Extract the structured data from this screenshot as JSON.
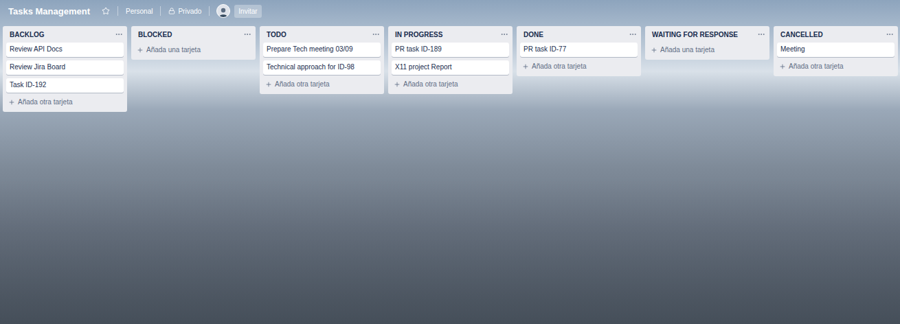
{
  "board": {
    "title": "Tasks Management",
    "starred": false,
    "team": "Personal",
    "visibility": "Privado",
    "invite": "Invitar"
  },
  "lists": [
    {
      "title": "BACKLOG",
      "cards": [
        "Review API Docs",
        "Review Jira Board",
        "Task ID-192"
      ],
      "add": "Añada otra tarjeta"
    },
    {
      "title": "BLOCKED",
      "cards": [],
      "add": "Añada una tarjeta"
    },
    {
      "title": "TODO",
      "cards": [
        "Prepare Tech meeting 03/09",
        "Technical approach for ID-98"
      ],
      "add": "Añada otra tarjeta"
    },
    {
      "title": "IN PROGRESS",
      "cards": [
        "PR task ID-189",
        "X11 project Report"
      ],
      "add": "Añada otra tarjeta"
    },
    {
      "title": "DONE",
      "cards": [
        "PR task ID-77"
      ],
      "add": "Añada otra tarjeta"
    },
    {
      "title": "WAITING FOR RESPONSE",
      "cards": [],
      "add": "Añada una tarjeta"
    },
    {
      "title": "CANCELLED",
      "cards": [
        "Meeting"
      ],
      "add": "Añada otra tarjeta"
    }
  ]
}
